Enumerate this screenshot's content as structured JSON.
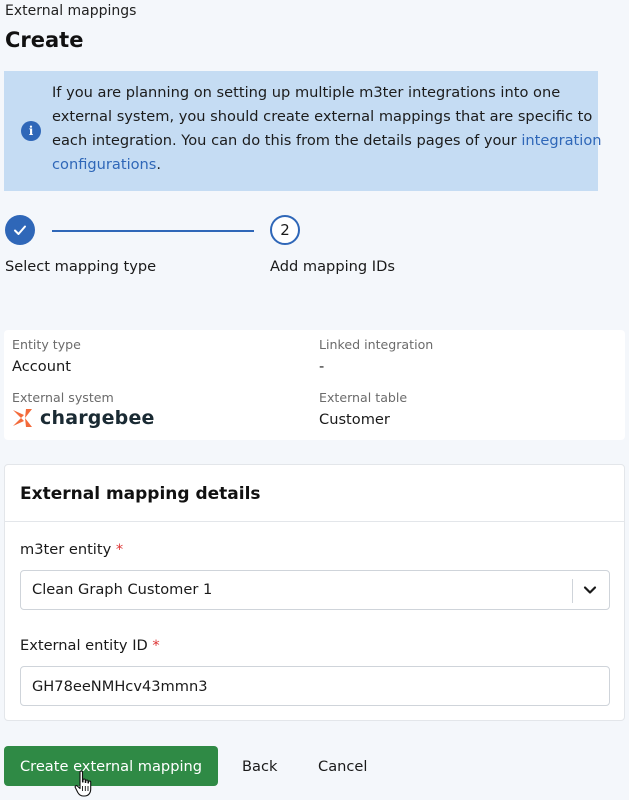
{
  "header": {
    "breadcrumb": "External mappings",
    "title": "Create"
  },
  "banner": {
    "icon": "info-icon",
    "text": "If you are planning on setting up multiple m3ter integrations into one external system, you should create external mappings that are specific to each integration. You can do this from the details pages of your ",
    "link": "integration configurations",
    "suffix": "."
  },
  "stepper": {
    "steps": [
      {
        "label": "Select mapping type",
        "status": "complete",
        "icon": "check-icon"
      },
      {
        "label": "Add mapping IDs",
        "status": "current",
        "number": "2"
      }
    ]
  },
  "summary": {
    "entity_type_label": "Entity type",
    "entity_type_value": "Account",
    "linked_integration_label": "Linked integration",
    "linked_integration_value": "-",
    "external_system_label": "External system",
    "external_system_value": "chargebee",
    "external_table_label": "External table",
    "external_table_value": "Customer"
  },
  "details": {
    "title": "External mapping details",
    "m3ter_entity_label": "m3ter entity",
    "m3ter_entity_value": "Clean Graph Customer 1",
    "external_entity_id_label": "External entity ID",
    "external_entity_id_value": "GH78eeNMHcv43mmn3",
    "required_marker": "*"
  },
  "actions": {
    "create_label": "Create external mapping",
    "back_label": "Back",
    "cancel_label": "Cancel"
  },
  "colors": {
    "accent": "#2f67b8",
    "banner_bg": "#c5dcf3",
    "primary_button": "#2f8a45",
    "chargebee_orange": "#f36a3a"
  }
}
